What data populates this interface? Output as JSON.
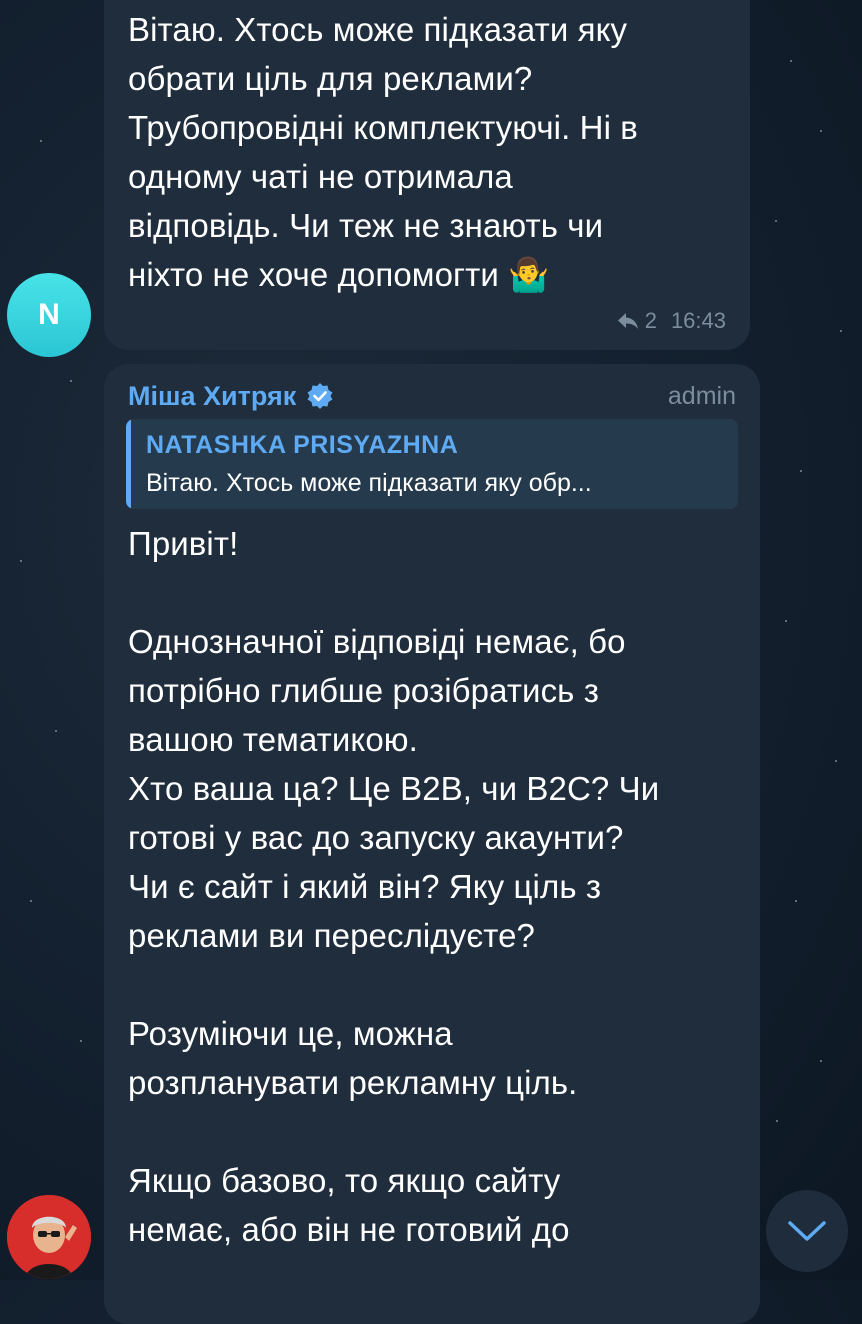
{
  "messages": [
    {
      "avatar_letter": "N",
      "text": "Вітаю. Хтось може підказати яку\nобрати ціль для реклами?\nТрубопровідні комплектуючі. Ні в\nодному чаті не отримала\nвідповідь. Чи теж не знають чи\nніхто не хоче допомогти 🤷‍♂️",
      "reply_count": "2",
      "time": "16:43"
    },
    {
      "sender": "Міша Хитряк",
      "role": "admin",
      "quote": {
        "name": "NATASHKA PRISYAZHNA",
        "text": "Вітаю. Хтось може підказати яку обр..."
      },
      "text": "Привіт!\n\nОднозначної відповіді немає, бо\nпотрібно глибше розібратись з\nвашою тематикою.\nХто ваша ца? Це B2B, чи B2C? Чи\nготові у вас до запуску акаунти?\nЧи є сайт і який він? Яку ціль з\nреклами ви переслідуєте?\n\nРозуміючи це, можна\nрозпланувати рекламну ціль.\n\nЯкщо базово, то якщо сайту\nнемає, або він не готовий до"
    }
  ],
  "icons": {
    "reply": "reply-arrow-icon",
    "verified": "verified-badge-icon",
    "scroll_down": "chevron-down-icon"
  },
  "colors": {
    "background": "#142130",
    "bubble": "#1f2d3c",
    "accent": "#5eaaf3",
    "avatar_n": "#36d2dc",
    "muted": "#7c8d9e"
  }
}
